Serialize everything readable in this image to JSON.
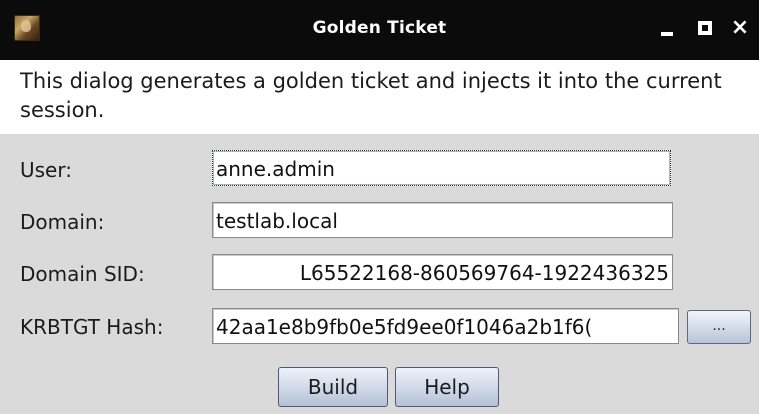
{
  "window": {
    "title": "Golden Ticket",
    "controls": {
      "minimize": "minimize",
      "maximize": "maximize",
      "close": "×"
    }
  },
  "description": "This dialog generates a golden ticket and injects it into the current session.",
  "form": {
    "user": {
      "label": "User:",
      "value": "anne.admin"
    },
    "domain": {
      "label": "Domain:",
      "value": "testlab.local"
    },
    "domain_sid": {
      "label": "Domain SID:",
      "value": "L65522168-860569764-1922436325"
    },
    "krbtgt_hash": {
      "label": "KRBTGT Hash:",
      "value": "42aa1e8b9fb0e5fd9ee0f1046a2b1f6("
    },
    "browse_label": "..."
  },
  "buttons": {
    "build": "Build",
    "help": "Help"
  },
  "icons": {
    "app": "golden-ticket-app-icon",
    "minimize": "minimize-icon",
    "maximize": "maximize-icon",
    "close": "close-icon"
  }
}
